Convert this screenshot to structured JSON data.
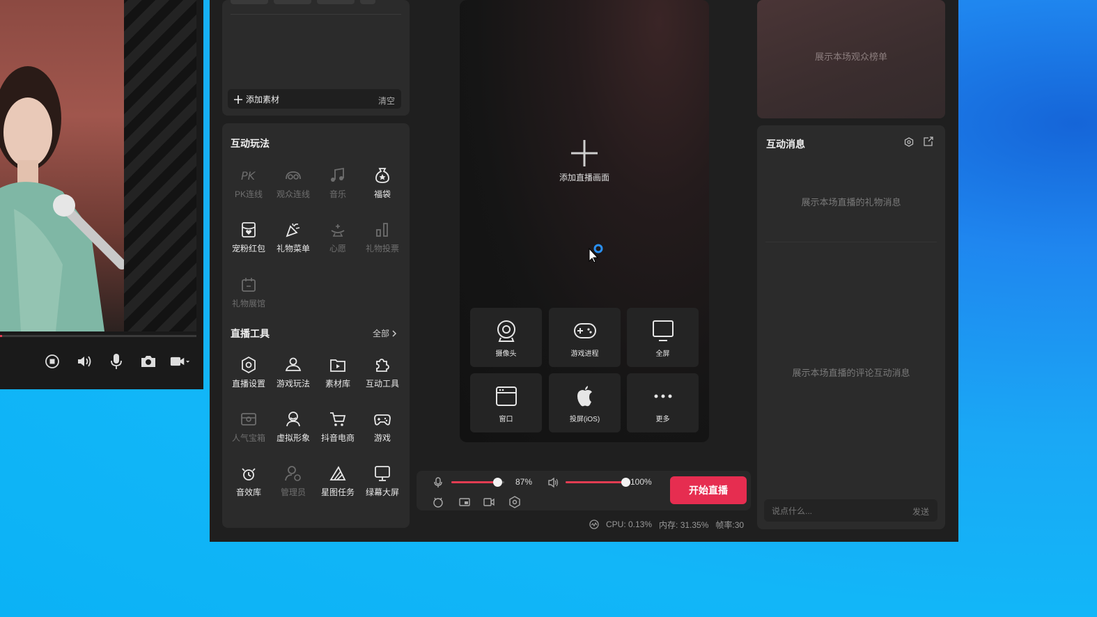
{
  "colors": {
    "accent": "#e62d50",
    "panel": "#2b2b2b",
    "background": "#1f1f1f",
    "desktop": "#12b6f8"
  },
  "left_preview": {
    "progress": 0.01,
    "controls": [
      "stop-icon",
      "volume-icon",
      "microphone-icon",
      "camera-icon",
      "video-camera-icon"
    ]
  },
  "materials": {
    "add_label": "添加素材",
    "clear_label": "清空"
  },
  "interactive": {
    "title": "互动玩法",
    "items": [
      {
        "label": "PK连线",
        "icon": "pk-icon",
        "enabled": false
      },
      {
        "label": "观众连线",
        "icon": "audience-link-icon",
        "enabled": false
      },
      {
        "label": "音乐",
        "icon": "music-icon",
        "enabled": false
      },
      {
        "label": "福袋",
        "icon": "lucky-bag-icon",
        "enabled": true
      },
      {
        "label": "宠粉红包",
        "icon": "red-packet-icon",
        "enabled": true
      },
      {
        "label": "礼物菜单",
        "icon": "gift-menu-icon",
        "enabled": true
      },
      {
        "label": "心愿",
        "icon": "wish-icon",
        "enabled": false
      },
      {
        "label": "礼物投票",
        "icon": "gift-vote-icon",
        "enabled": false
      },
      {
        "label": "礼物展馆",
        "icon": "gift-hall-icon",
        "enabled": false
      }
    ]
  },
  "tools": {
    "title": "直播工具",
    "all_label": "全部",
    "items": [
      {
        "label": "直播设置",
        "icon": "live-settings-icon",
        "enabled": true
      },
      {
        "label": "游戏玩法",
        "icon": "game-play-icon",
        "enabled": true
      },
      {
        "label": "素材库",
        "icon": "material-library-icon",
        "enabled": true
      },
      {
        "label": "互动工具",
        "icon": "interactive-tools-icon",
        "enabled": true
      },
      {
        "label": "人气宝箱",
        "icon": "treasure-box-icon",
        "enabled": false
      },
      {
        "label": "虚拟形象",
        "icon": "avatar-icon",
        "enabled": true
      },
      {
        "label": "抖音电商",
        "icon": "cart-icon",
        "enabled": true
      },
      {
        "label": "游戏",
        "icon": "gamepad-icon",
        "enabled": true
      },
      {
        "label": "音效库",
        "icon": "sound-effects-icon",
        "enabled": true
      },
      {
        "label": "管理员",
        "icon": "admin-icon",
        "enabled": false
      },
      {
        "label": "星图任务",
        "icon": "star-task-icon",
        "enabled": true
      },
      {
        "label": "绿幕大屏",
        "icon": "green-screen-icon",
        "enabled": true
      }
    ]
  },
  "preview": {
    "add_label": "添加直播画面",
    "sources": [
      {
        "label": "摄像头",
        "icon": "webcam-icon"
      },
      {
        "label": "游戏进程",
        "icon": "game-process-icon"
      },
      {
        "label": "全屏",
        "icon": "monitor-icon"
      },
      {
        "label": "窗口",
        "icon": "window-icon"
      },
      {
        "label": "投屏(iOS)",
        "icon": "apple-icon"
      },
      {
        "label": "更多",
        "icon": "more-icon"
      }
    ]
  },
  "audio": {
    "mic_level": 0.87,
    "mic_label": "87%",
    "speaker_level": 1.0,
    "speaker_label": "100%",
    "start_label": "开始直播"
  },
  "status": {
    "cpu": "CPU: 0.13%",
    "memory": "内存: 31.35%",
    "fps": "帧率:30"
  },
  "right": {
    "rank_placeholder": "展示本场观众榜单",
    "messages_title": "互动消息",
    "gift_placeholder": "展示本场直播的礼物消息",
    "comment_placeholder": "展示本场直播的评论互动消息",
    "input_placeholder": "说点什么...",
    "send_label": "发送"
  }
}
